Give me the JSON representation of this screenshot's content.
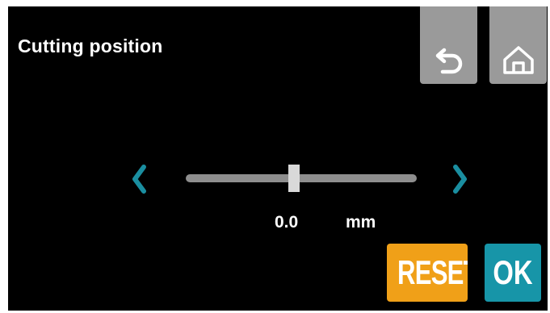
{
  "header": {
    "title": "Cutting position"
  },
  "toolbar": {
    "back_icon": "undo-arrow-icon",
    "home_icon": "home-icon"
  },
  "slider": {
    "value_text": "0.0",
    "unit": "mm",
    "level_fraction": 0.47,
    "left_icon": "chevron-left-icon",
    "right_icon": "chevron-right-icon"
  },
  "actions": {
    "reset_label": "RESET",
    "ok_label": "OK"
  },
  "colors": {
    "background": "#000000",
    "top_button": "#9a9a9a",
    "arrow": "#1a8ea0",
    "reset": "#f0a018",
    "ok": "#1795a8",
    "track": "#8e8e8e",
    "thumb": "#d9d9d9"
  }
}
